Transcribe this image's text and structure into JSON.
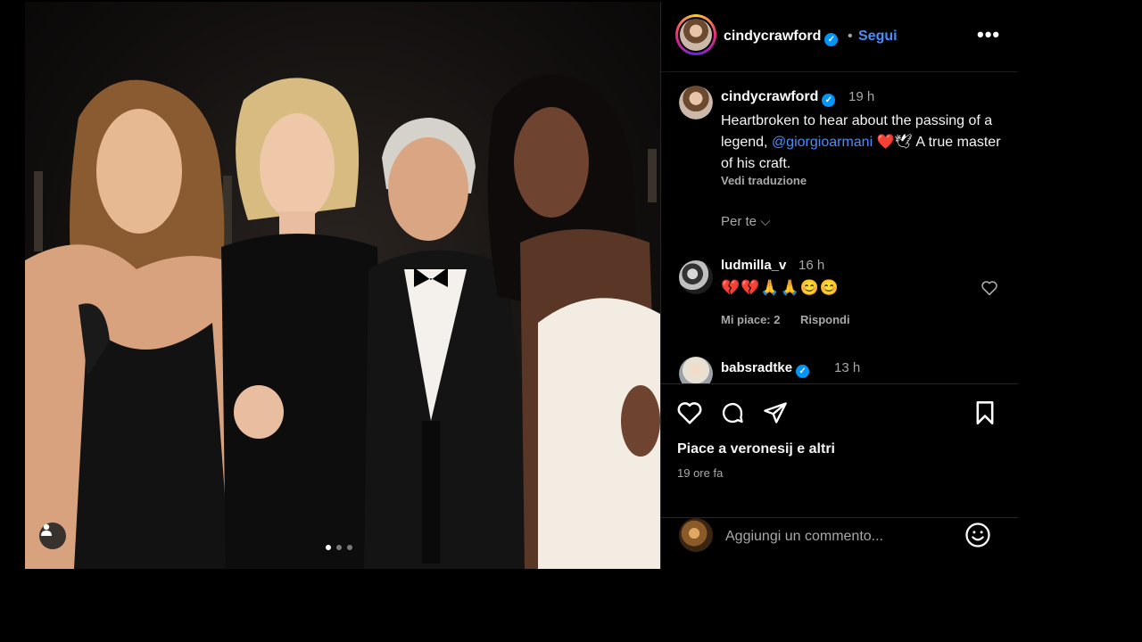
{
  "post": {
    "image_alt": "",
    "carousel": {
      "count": 3,
      "active": 1
    }
  },
  "header": {
    "username": "cindycrawford",
    "separator": "•",
    "follow_label": "Segui",
    "more_label": "•••"
  },
  "caption": {
    "username": "cindycrawford",
    "time": "19 h",
    "text_before": "Heartbroken to hear about the passing of a legend, ",
    "mention": "@giorgioarmani",
    "text_after": " ❤️🕊 A true master of his craft.",
    "translate_label": "Vedi traduzione"
  },
  "sort": {
    "label": "Per te ⌵"
  },
  "comments": [
    {
      "username": "ludmilla_v",
      "time": "16 h",
      "text": "💔💔🙏🙏😊😊",
      "likes_label": "Mi piace: 2",
      "reply_label": "Rispondi"
    },
    {
      "username": "babsradtke",
      "time": "13 h"
    }
  ],
  "actions": {
    "liked_by": "Piace a veronesij e altri",
    "time_ago": "19 ore fa"
  },
  "composer": {
    "placeholder": "Aggiungi un commento..."
  },
  "colors": {
    "link_blue": "#4a8dfc",
    "verified_blue": "#0095f6",
    "muted": "#a8a8a8"
  }
}
